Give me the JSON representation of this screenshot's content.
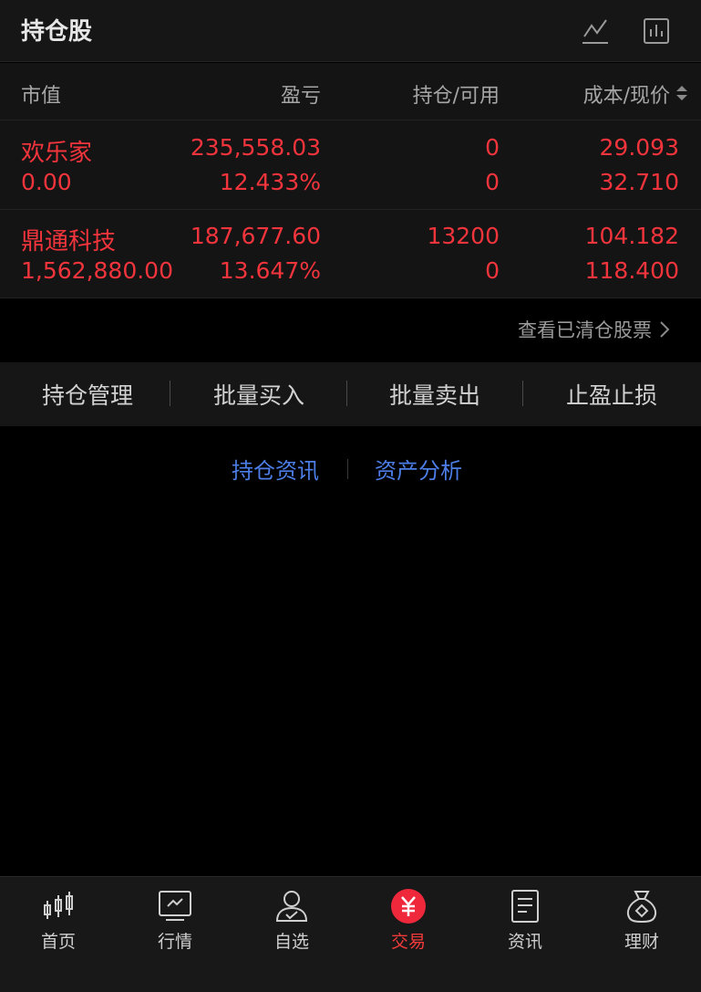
{
  "header": {
    "title": "持仓股",
    "icons": [
      "trend-line-icon",
      "bar-chart-icon"
    ]
  },
  "table": {
    "columns": [
      "市值",
      "盈亏",
      "持仓/可用",
      "成本/现价"
    ],
    "sort_icon": "sort-updown-icon",
    "rows": [
      {
        "name": "欢乐家",
        "market_value": "0.00",
        "profit": "235,558.03",
        "profit_pct": "12.433%",
        "position": "0",
        "available": "0",
        "cost": "29.093",
        "price": "32.710"
      },
      {
        "name": "鼎通科技",
        "market_value": "1,562,880.00",
        "profit": "187,677.60",
        "profit_pct": "13.647%",
        "position": "13200",
        "available": "0",
        "cost": "104.182",
        "price": "118.400"
      }
    ]
  },
  "cleared_link": "查看已清仓股票",
  "actions": [
    "持仓管理",
    "批量买入",
    "批量卖出",
    "止盈止损"
  ],
  "info_links": [
    "持仓资讯",
    "资产分析"
  ],
  "nav": [
    {
      "label": "首页",
      "icon": "candlestick-icon"
    },
    {
      "label": "行情",
      "icon": "market-chart-icon"
    },
    {
      "label": "自选",
      "icon": "user-check-icon"
    },
    {
      "label": "交易",
      "icon": "yuan-coin-icon"
    },
    {
      "label": "资讯",
      "icon": "document-icon"
    },
    {
      "label": "理财",
      "icon": "money-bag-icon"
    }
  ],
  "colors": {
    "up": "#f2343c",
    "link": "#4d7ee8",
    "active_tab": "#f23a3a",
    "background": "#000000",
    "panel": "#141414"
  }
}
